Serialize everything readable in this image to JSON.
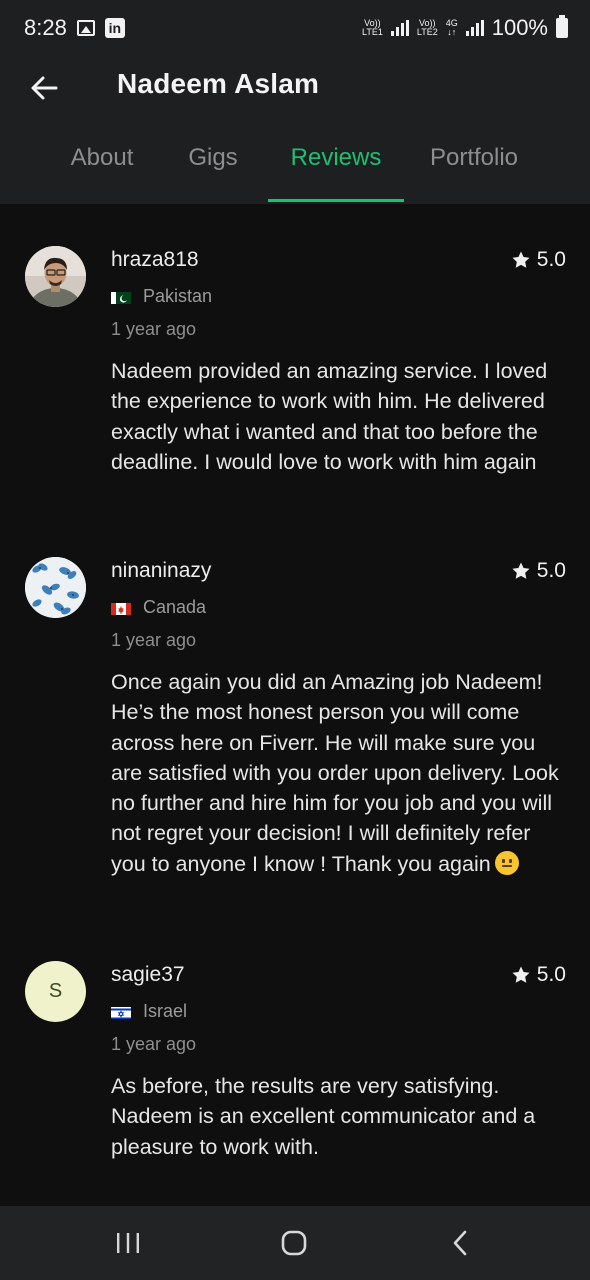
{
  "status_bar": {
    "time": "8:28",
    "sim1_label_top": "Vo))",
    "sim1_label_bottom": "LTE1",
    "sim2_label_top": "Vo))",
    "sim2_label_bottom": "LTE2",
    "network_type": "4G",
    "battery_text": "100%"
  },
  "header": {
    "title": "Nadeem Aslam"
  },
  "tabs": [
    {
      "label": "About",
      "active": false
    },
    {
      "label": "Gigs",
      "active": false
    },
    {
      "label": "Reviews",
      "active": true
    },
    {
      "label": "Portfolio",
      "active": false
    }
  ],
  "reviews": [
    {
      "username": "hraza818",
      "rating": "5.0",
      "country": "Pakistan",
      "time_ago": "1 year ago",
      "text": "Nadeem provided an amazing service. I loved the experience to work with him. He delivered exactly what i wanted and that too before the deadline. I would love to work with him again"
    },
    {
      "username": "ninaninazy",
      "rating": "5.0",
      "country": "Canada",
      "time_ago": "1 year ago",
      "text": "Once again you did an Amazing job Nadeem! He’s the most honest person you will come across here on Fiverr. He will make sure you are satisfied with you order upon delivery. Look no further and hire him for you job and you will not regret your decision! I will definitely refer you to anyone I know ! Thank you again"
    },
    {
      "username": "sagie37",
      "avatar_initial": "S",
      "rating": "5.0",
      "country": "Israel",
      "time_ago": "1 year ago",
      "text": "As before, the results are very satisfying. Nadeem is an excellent communicator and a pleasure to work with."
    }
  ],
  "colors": {
    "accent": "#1dbf73",
    "header_bg": "#1e1f20",
    "body_bg": "#0f0f10"
  },
  "icons": {
    "back": "arrow-left-icon",
    "star": "star-icon",
    "nav_recents": "recent-apps-icon",
    "nav_home": "home-icon",
    "nav_back": "nav-back-icon"
  }
}
